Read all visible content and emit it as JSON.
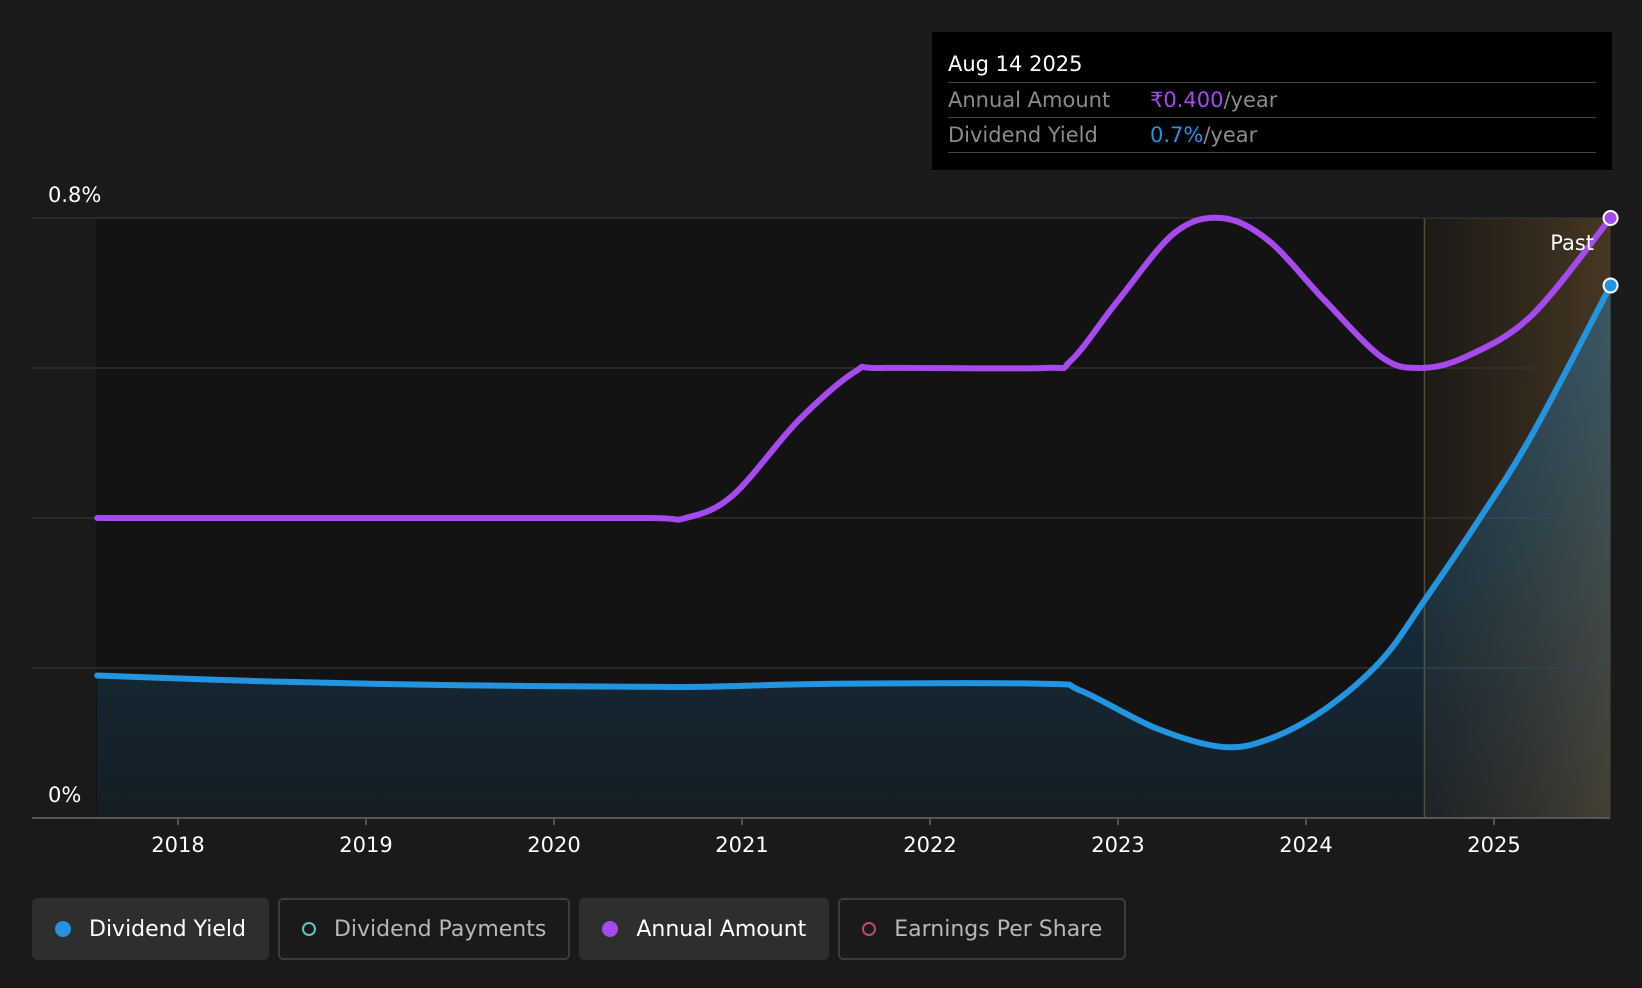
{
  "chart_data": {
    "type": "line",
    "y_axis": {
      "top_label": "0.8%",
      "bottom_label": "0%",
      "ylim": [
        0,
        0.8
      ],
      "grid": true,
      "gridlines": [
        0,
        0.2,
        0.4,
        0.6,
        0.8
      ]
    },
    "x_axis": {
      "tick_labels": [
        "2018",
        "2019",
        "2020",
        "2021",
        "2022",
        "2023",
        "2024",
        "2025"
      ],
      "xlim": [
        2017.57,
        2025.62
      ]
    },
    "past_region": {
      "label": "Past",
      "start": 2024.63,
      "end": 2025.62
    },
    "series": [
      {
        "name": "Annual Amount",
        "color": "#a64af0",
        "points": [
          [
            2017.57,
            0.4
          ],
          [
            2018.5,
            0.4
          ],
          [
            2019.5,
            0.4
          ],
          [
            2020.5,
            0.4
          ],
          [
            2020.7,
            0.4
          ],
          [
            2020.95,
            0.43
          ],
          [
            2021.3,
            0.53
          ],
          [
            2021.6,
            0.595
          ],
          [
            2021.75,
            0.6
          ],
          [
            2022.6,
            0.6
          ],
          [
            2022.75,
            0.61
          ],
          [
            2023.0,
            0.69
          ],
          [
            2023.3,
            0.78
          ],
          [
            2023.55,
            0.8
          ],
          [
            2023.8,
            0.77
          ],
          [
            2024.1,
            0.69
          ],
          [
            2024.4,
            0.615
          ],
          [
            2024.6,
            0.6
          ],
          [
            2024.85,
            0.615
          ],
          [
            2025.2,
            0.67
          ],
          [
            2025.62,
            0.8
          ]
        ]
      },
      {
        "name": "Dividend Yield",
        "color": "#2394e0",
        "points": [
          [
            2017.57,
            0.19
          ],
          [
            2018.5,
            0.182
          ],
          [
            2019.5,
            0.177
          ],
          [
            2020.5,
            0.175
          ],
          [
            2020.8,
            0.175
          ],
          [
            2021.5,
            0.179
          ],
          [
            2022.6,
            0.179
          ],
          [
            2022.8,
            0.17
          ],
          [
            2023.2,
            0.12
          ],
          [
            2023.55,
            0.095
          ],
          [
            2023.8,
            0.105
          ],
          [
            2024.1,
            0.145
          ],
          [
            2024.4,
            0.21
          ],
          [
            2024.63,
            0.29
          ],
          [
            2024.9,
            0.39
          ],
          [
            2025.2,
            0.51
          ],
          [
            2025.62,
            0.71
          ]
        ]
      }
    ]
  },
  "tooltip": {
    "date": "Aug 14 2025",
    "rows": [
      {
        "label": "Annual Amount",
        "value": "₹0.400",
        "unit": "/year",
        "color": "#a64af0"
      },
      {
        "label": "Dividend Yield",
        "value": "0.7%",
        "unit": "/year",
        "color": "#2394e0"
      }
    ]
  },
  "legend": [
    {
      "label": "Dividend Yield",
      "color": "#2394e0",
      "active": true,
      "marker": "filled"
    },
    {
      "label": "Dividend Payments",
      "color": "#5bc8c0",
      "active": false,
      "marker": "ring"
    },
    {
      "label": "Annual Amount",
      "color": "#a64af0",
      "active": true,
      "marker": "filled"
    },
    {
      "label": "Earnings Per Share",
      "color": "#c0457e",
      "active": false,
      "marker": "ring"
    }
  ]
}
